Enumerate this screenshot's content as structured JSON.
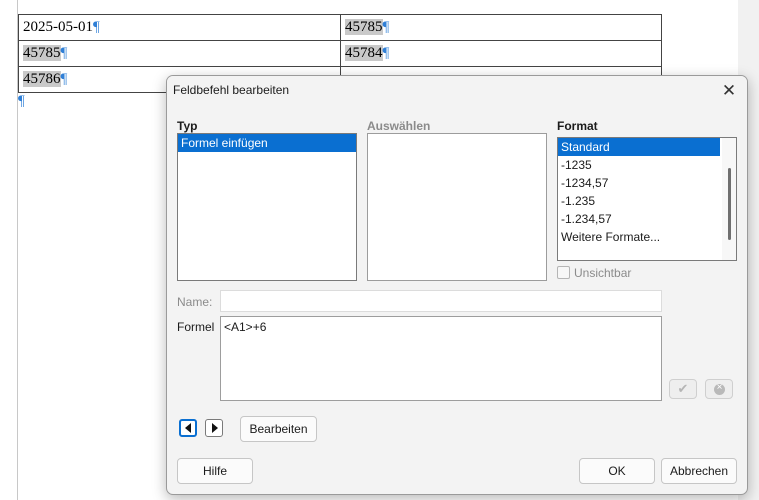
{
  "document": {
    "table": {
      "rows": [
        [
          "2025-05-01",
          "45785"
        ],
        [
          "45785",
          "45784"
        ],
        [
          "45786",
          ""
        ]
      ]
    },
    "pilcrow": "¶"
  },
  "dialog": {
    "title": "Feldbefehl bearbeiten",
    "close_icon": "close-icon",
    "typ": {
      "label": "Typ",
      "items": [
        "Formel einfügen"
      ],
      "selected_index": 0
    },
    "auswaehlen": {
      "label": "Auswählen",
      "items": []
    },
    "format": {
      "label": "Format",
      "items": [
        "Standard",
        "-1235",
        "-1234,57",
        "-1.235",
        "-1.234,57",
        "Weitere Formate..."
      ],
      "selected_index": 0
    },
    "unsichtbar": {
      "label": "Unsichtbar",
      "checked": false
    },
    "name": {
      "label": "Name:",
      "value": ""
    },
    "formel": {
      "label": "Formel",
      "value": "<A1>+6"
    },
    "buttons": {
      "apply_icon": "check-icon",
      "clear_icon": "clear-circle-icon",
      "prev_icon": "triangle-left-icon",
      "next_icon": "triangle-right-icon",
      "edit": "Bearbeiten",
      "help": "Hilfe",
      "ok": "OK",
      "cancel": "Abbrechen"
    }
  },
  "colors": {
    "selection": "#0a6fd1",
    "field_shading": "#c9c9c9",
    "formatting_mark": "#2f7fd6"
  }
}
